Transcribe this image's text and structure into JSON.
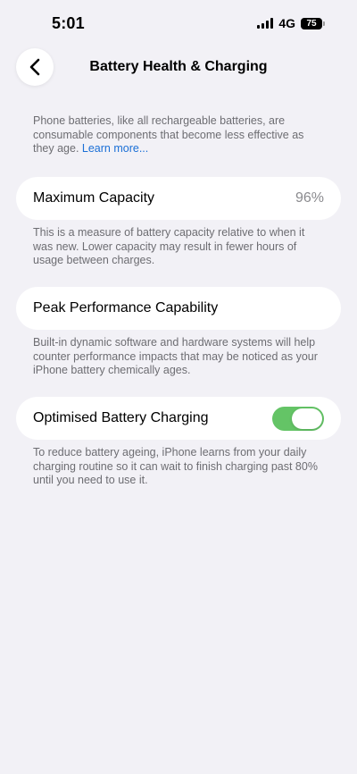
{
  "status_bar": {
    "time": "5:01",
    "network": "4G",
    "battery_level": "75"
  },
  "nav": {
    "back_icon": "chevron-left-icon",
    "title": "Battery Health & Charging"
  },
  "intro": {
    "text": "Phone batteries, like all rechargeable batteries, are consumable components that become less effective as they age. ",
    "link": "Learn more..."
  },
  "maximum_capacity": {
    "label": "Maximum Capacity",
    "value": "96%",
    "description": "This is a measure of battery capacity relative to when it was new. Lower capacity may result in fewer hours of usage between charges."
  },
  "peak_performance": {
    "label": "Peak Performance Capability",
    "description": "Built-in dynamic software and hardware systems will help counter performance impacts that may be noticed as your iPhone battery chemically ages."
  },
  "optimised_charging": {
    "label": "Optimised Battery Charging",
    "enabled": true,
    "toggle_color": "#64c466",
    "description": "To reduce battery ageing, iPhone learns from your daily charging routine so it can wait to finish charging past 80% until you need to use it."
  },
  "colors": {
    "background": "#f2f1f6",
    "link": "#1a6fd6",
    "secondary_text": "#6d6d72"
  }
}
